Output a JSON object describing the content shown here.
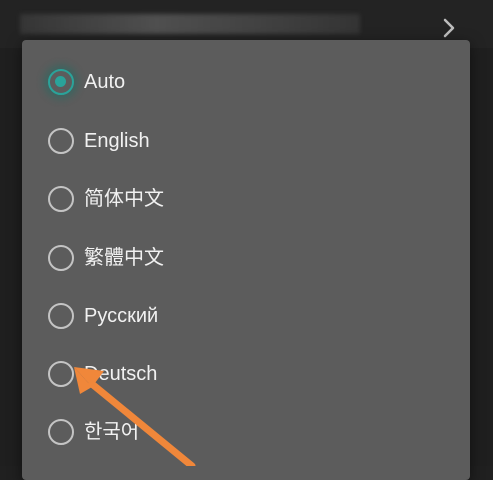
{
  "language_options": [
    {
      "label": "Auto",
      "selected": true
    },
    {
      "label": "English",
      "selected": false
    },
    {
      "label": "简体中文",
      "selected": false
    },
    {
      "label": "繁體中文",
      "selected": false
    },
    {
      "label": "Русский",
      "selected": false
    },
    {
      "label": "Deutsch",
      "selected": false
    },
    {
      "label": "한국어",
      "selected": false
    }
  ],
  "colors": {
    "accent": "#2aa39a",
    "dialog_bg": "#5c5c5c",
    "annotation_arrow": "#f0873a"
  },
  "icons": {
    "back_chevron": "chevron-right-icon",
    "annotation": "arrow-pointer-icon"
  }
}
